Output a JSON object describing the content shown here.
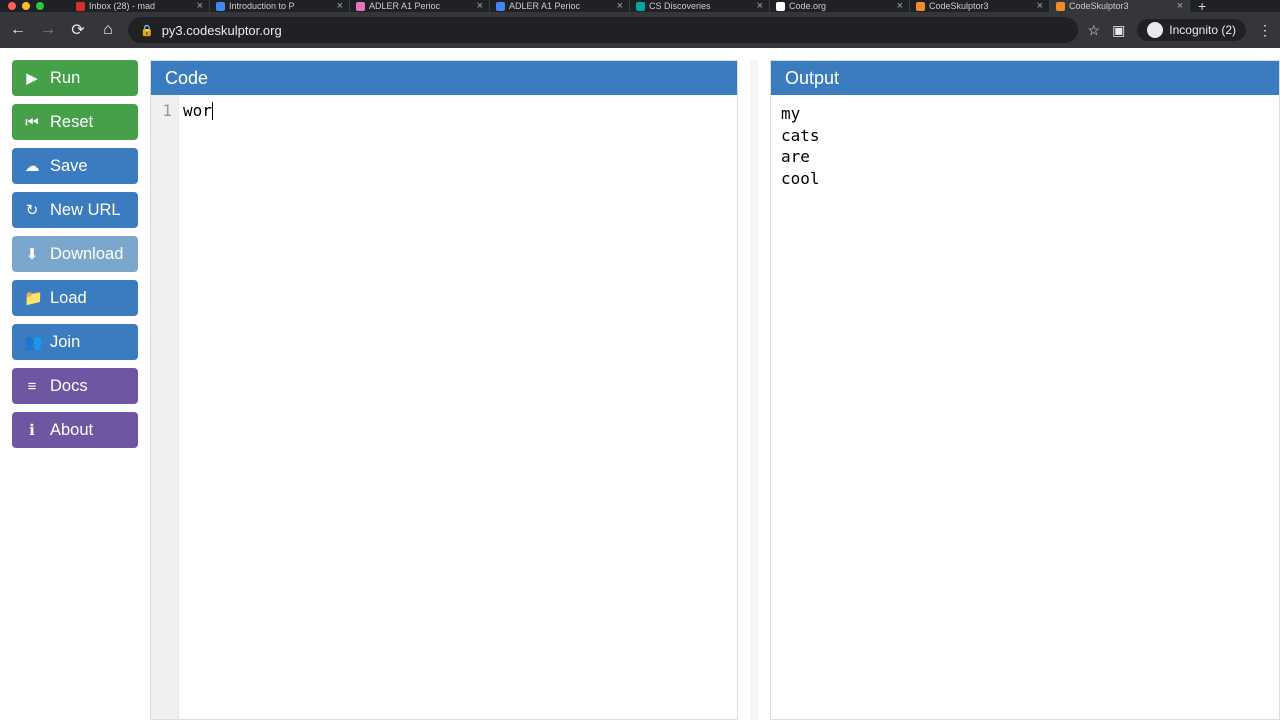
{
  "browser": {
    "url": "py3.codeskulptor.org",
    "incognito_label": "Incognito (2)",
    "tabs": [
      {
        "title": "Inbox (28) - mad",
        "favicon": "#d93025"
      },
      {
        "title": "Introduction to P",
        "favicon": "#4285f4"
      },
      {
        "title": "ADLER A1 Perioc",
        "favicon": "#e573c0"
      },
      {
        "title": "ADLER A1 Perioc",
        "favicon": "#4285f4"
      },
      {
        "title": "CS Discoveries",
        "favicon": "#00a99d"
      },
      {
        "title": "Code.org",
        "favicon": "#ffffff"
      },
      {
        "title": "CodeSkulptor3",
        "favicon": "#f28b2b"
      },
      {
        "title": "CodeSkulptor3",
        "favicon": "#f28b2b",
        "active": true
      }
    ]
  },
  "sidebar": {
    "buttons": [
      {
        "name": "run-button",
        "label": "Run",
        "icon": "▶",
        "color": "btn-green"
      },
      {
        "name": "reset-button",
        "label": "Reset",
        "icon": "⏮",
        "color": "btn-green"
      },
      {
        "name": "save-button",
        "label": "Save",
        "icon": "☁",
        "color": "btn-blue"
      },
      {
        "name": "new-url-button",
        "label": "New URL",
        "icon": "↻",
        "color": "btn-blue"
      },
      {
        "name": "download-button",
        "label": "Download",
        "icon": "⬇",
        "color": "btn-lblue"
      },
      {
        "name": "load-button",
        "label": "Load",
        "icon": "📁",
        "color": "btn-blue"
      },
      {
        "name": "join-button",
        "label": "Join",
        "icon": "👥",
        "color": "btn-blue"
      },
      {
        "name": "docs-button",
        "label": "Docs",
        "icon": "≡",
        "color": "btn-purple"
      },
      {
        "name": "about-button",
        "label": "About",
        "icon": "ℹ",
        "color": "btn-purple"
      }
    ]
  },
  "code_panel": {
    "title": "Code",
    "lines": [
      {
        "num": "1",
        "text": "wor"
      }
    ]
  },
  "output_panel": {
    "title": "Output",
    "text": "my\ncats\nare\ncool"
  }
}
